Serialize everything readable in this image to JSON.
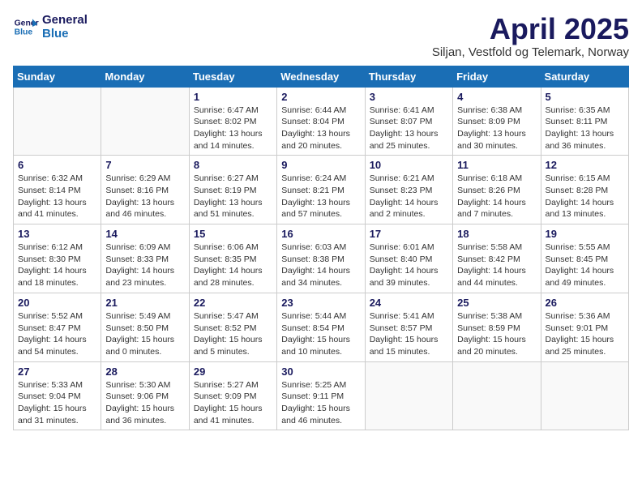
{
  "logo": {
    "line1": "General",
    "line2": "Blue"
  },
  "title": "April 2025",
  "subtitle": "Siljan, Vestfold og Telemark, Norway",
  "weekdays": [
    "Sunday",
    "Monday",
    "Tuesday",
    "Wednesday",
    "Thursday",
    "Friday",
    "Saturday"
  ],
  "weeks": [
    [
      {
        "day": "",
        "info": ""
      },
      {
        "day": "",
        "info": ""
      },
      {
        "day": "1",
        "info": "Sunrise: 6:47 AM\nSunset: 8:02 PM\nDaylight: 13 hours and 14 minutes."
      },
      {
        "day": "2",
        "info": "Sunrise: 6:44 AM\nSunset: 8:04 PM\nDaylight: 13 hours and 20 minutes."
      },
      {
        "day": "3",
        "info": "Sunrise: 6:41 AM\nSunset: 8:07 PM\nDaylight: 13 hours and 25 minutes."
      },
      {
        "day": "4",
        "info": "Sunrise: 6:38 AM\nSunset: 8:09 PM\nDaylight: 13 hours and 30 minutes."
      },
      {
        "day": "5",
        "info": "Sunrise: 6:35 AM\nSunset: 8:11 PM\nDaylight: 13 hours and 36 minutes."
      }
    ],
    [
      {
        "day": "6",
        "info": "Sunrise: 6:32 AM\nSunset: 8:14 PM\nDaylight: 13 hours and 41 minutes."
      },
      {
        "day": "7",
        "info": "Sunrise: 6:29 AM\nSunset: 8:16 PM\nDaylight: 13 hours and 46 minutes."
      },
      {
        "day": "8",
        "info": "Sunrise: 6:27 AM\nSunset: 8:19 PM\nDaylight: 13 hours and 51 minutes."
      },
      {
        "day": "9",
        "info": "Sunrise: 6:24 AM\nSunset: 8:21 PM\nDaylight: 13 hours and 57 minutes."
      },
      {
        "day": "10",
        "info": "Sunrise: 6:21 AM\nSunset: 8:23 PM\nDaylight: 14 hours and 2 minutes."
      },
      {
        "day": "11",
        "info": "Sunrise: 6:18 AM\nSunset: 8:26 PM\nDaylight: 14 hours and 7 minutes."
      },
      {
        "day": "12",
        "info": "Sunrise: 6:15 AM\nSunset: 8:28 PM\nDaylight: 14 hours and 13 minutes."
      }
    ],
    [
      {
        "day": "13",
        "info": "Sunrise: 6:12 AM\nSunset: 8:30 PM\nDaylight: 14 hours and 18 minutes."
      },
      {
        "day": "14",
        "info": "Sunrise: 6:09 AM\nSunset: 8:33 PM\nDaylight: 14 hours and 23 minutes."
      },
      {
        "day": "15",
        "info": "Sunrise: 6:06 AM\nSunset: 8:35 PM\nDaylight: 14 hours and 28 minutes."
      },
      {
        "day": "16",
        "info": "Sunrise: 6:03 AM\nSunset: 8:38 PM\nDaylight: 14 hours and 34 minutes."
      },
      {
        "day": "17",
        "info": "Sunrise: 6:01 AM\nSunset: 8:40 PM\nDaylight: 14 hours and 39 minutes."
      },
      {
        "day": "18",
        "info": "Sunrise: 5:58 AM\nSunset: 8:42 PM\nDaylight: 14 hours and 44 minutes."
      },
      {
        "day": "19",
        "info": "Sunrise: 5:55 AM\nSunset: 8:45 PM\nDaylight: 14 hours and 49 minutes."
      }
    ],
    [
      {
        "day": "20",
        "info": "Sunrise: 5:52 AM\nSunset: 8:47 PM\nDaylight: 14 hours and 54 minutes."
      },
      {
        "day": "21",
        "info": "Sunrise: 5:49 AM\nSunset: 8:50 PM\nDaylight: 15 hours and 0 minutes."
      },
      {
        "day": "22",
        "info": "Sunrise: 5:47 AM\nSunset: 8:52 PM\nDaylight: 15 hours and 5 minutes."
      },
      {
        "day": "23",
        "info": "Sunrise: 5:44 AM\nSunset: 8:54 PM\nDaylight: 15 hours and 10 minutes."
      },
      {
        "day": "24",
        "info": "Sunrise: 5:41 AM\nSunset: 8:57 PM\nDaylight: 15 hours and 15 minutes."
      },
      {
        "day": "25",
        "info": "Sunrise: 5:38 AM\nSunset: 8:59 PM\nDaylight: 15 hours and 20 minutes."
      },
      {
        "day": "26",
        "info": "Sunrise: 5:36 AM\nSunset: 9:01 PM\nDaylight: 15 hours and 25 minutes."
      }
    ],
    [
      {
        "day": "27",
        "info": "Sunrise: 5:33 AM\nSunset: 9:04 PM\nDaylight: 15 hours and 31 minutes."
      },
      {
        "day": "28",
        "info": "Sunrise: 5:30 AM\nSunset: 9:06 PM\nDaylight: 15 hours and 36 minutes."
      },
      {
        "day": "29",
        "info": "Sunrise: 5:27 AM\nSunset: 9:09 PM\nDaylight: 15 hours and 41 minutes."
      },
      {
        "day": "30",
        "info": "Sunrise: 5:25 AM\nSunset: 9:11 PM\nDaylight: 15 hours and 46 minutes."
      },
      {
        "day": "",
        "info": ""
      },
      {
        "day": "",
        "info": ""
      },
      {
        "day": "",
        "info": ""
      }
    ]
  ]
}
